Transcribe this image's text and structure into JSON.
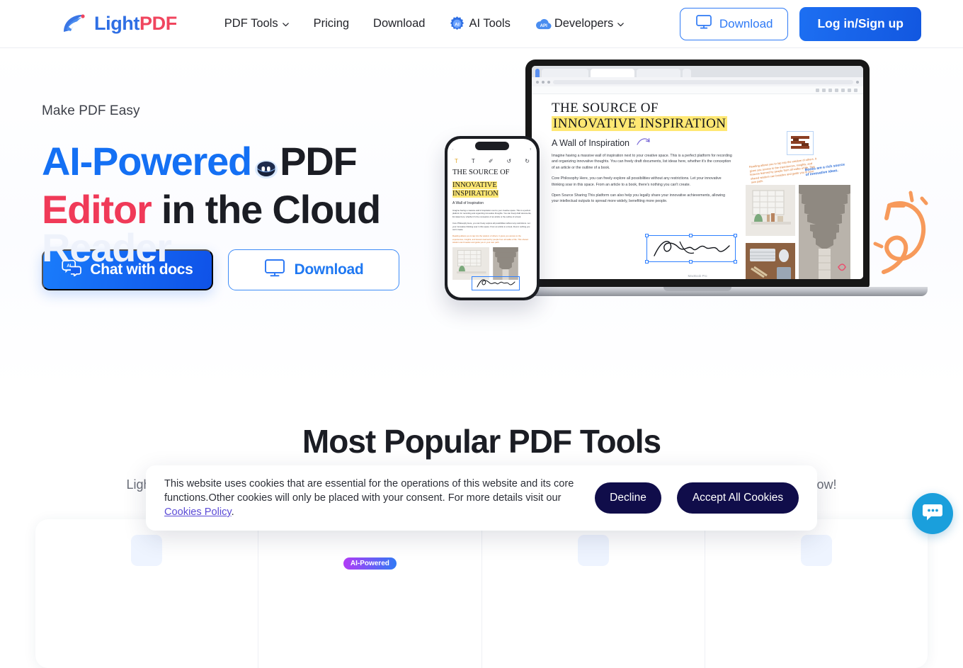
{
  "header": {
    "logo": {
      "light": "Light",
      "pdf": "PDF",
      "icon": "lightpdf-logo-icon"
    },
    "nav": [
      {
        "label": "PDF Tools",
        "has_chevron": true,
        "icon": null
      },
      {
        "label": "Pricing",
        "has_chevron": false,
        "icon": null
      },
      {
        "label": "Download",
        "has_chevron": false,
        "icon": null
      },
      {
        "label": "AI Tools",
        "has_chevron": false,
        "icon": "ai-gear-icon"
      },
      {
        "label": "Developers",
        "has_chevron": true,
        "icon": "api-cloud-icon"
      }
    ],
    "download_button": "Download",
    "login_button": "Log in/Sign up"
  },
  "hero": {
    "eyebrow": "Make PDF Easy",
    "line1_blue": "AI-Powered",
    "line1_rest": "PDF",
    "line2_red": "Editor",
    "line2_rest": " in the Cloud",
    "line3_ghost": "Reader",
    "chat_button": "Chat with docs",
    "download_button": "Download",
    "device_doc": {
      "title_line1": "THE SOURCE OF",
      "title_line2": "INNOVATIVE INSPIRATION",
      "subtitle": "A Wall of Inspiration",
      "para1": "Imagine having a massive wall of inspiration next to your creative space. This is a perfect platform for recording and organizing innovative thoughts. You can freely draft documents, list ideas here, whether it's the conception of an article or the outline of a book.",
      "para2": "Core Philosophy Here, you can freely explore all possibilities without any restrictions. Let your innovative thinking soar in this space. From an article to a book, there's nothing you can't create.",
      "para3": "Open Source Sharing This platform can also help you legally share your innovative achievements, allowing your intellectual outputs to spread more widely, benefiting more people.",
      "note_orange": "Reading allows you to tap into the wisdom of others. It gives you access to the experiences, insights, and lessons learned by people from all walks of life. This shared wisdom can broaden and guide you in your own path.",
      "note_blue": "Books are a rich source of innovative ideas.",
      "macbook_label": "MacBook Pro"
    }
  },
  "tools_section": {
    "title": "Most Popular PDF Tools",
    "subtitle_start": "LightPDF",
    "subtitle_end": "now!",
    "ai_pill": "AI-Powered"
  },
  "cookie": {
    "text_a": "This website uses cookies that are essential for the operations of this website and its core functions.Other cookies will only be placed with your consent. For more details visit our ",
    "link": "Cookies Policy",
    "text_b": ".",
    "decline": "Decline",
    "accept": "Accept All Cookies"
  },
  "chat": {
    "icon": "chat-bubble-icon"
  },
  "colors": {
    "brand_blue": "#1470f4",
    "brand_red": "#f03a58",
    "login_blue": "#1257e0",
    "cookie_dark": "#100d4a",
    "cookie_link": "#5b4bd6",
    "chat_blue": "#1a9fdc",
    "ai_pill_from": "#b33bf6",
    "ai_pill_to": "#2f7af5"
  }
}
